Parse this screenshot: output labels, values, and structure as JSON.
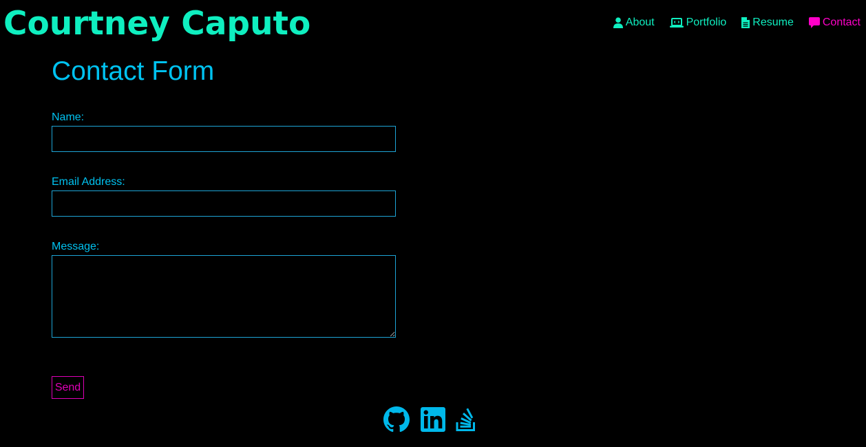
{
  "colors": {
    "title": "#0fefc0",
    "nav_link": "#0fefc0",
    "nav_active": "#ff00c8",
    "form_text": "#00c2f0",
    "field_border": "#1ea6d8",
    "send": "#e000b8",
    "social_icons": "#00b8ea"
  },
  "header": {
    "site_title": "Courtney Caputo",
    "nav": [
      {
        "label": "About",
        "icon": "user-icon",
        "active": false
      },
      {
        "label": "Portfolio",
        "icon": "laptop-code-icon",
        "active": false
      },
      {
        "label": "Resume",
        "icon": "file-icon",
        "active": false
      },
      {
        "label": "Contact",
        "icon": "comment-icon",
        "active": true
      }
    ]
  },
  "contact_form": {
    "heading": "Contact Form",
    "name_label": "Name:",
    "name_value": "",
    "email_label": "Email Address:",
    "email_value": "",
    "message_label": "Message:",
    "message_value": "",
    "send_label": "Send"
  },
  "footer": {
    "social_links": [
      {
        "icon": "github-icon"
      },
      {
        "icon": "linkedin-icon"
      },
      {
        "icon": "stack-overflow-icon"
      }
    ]
  }
}
